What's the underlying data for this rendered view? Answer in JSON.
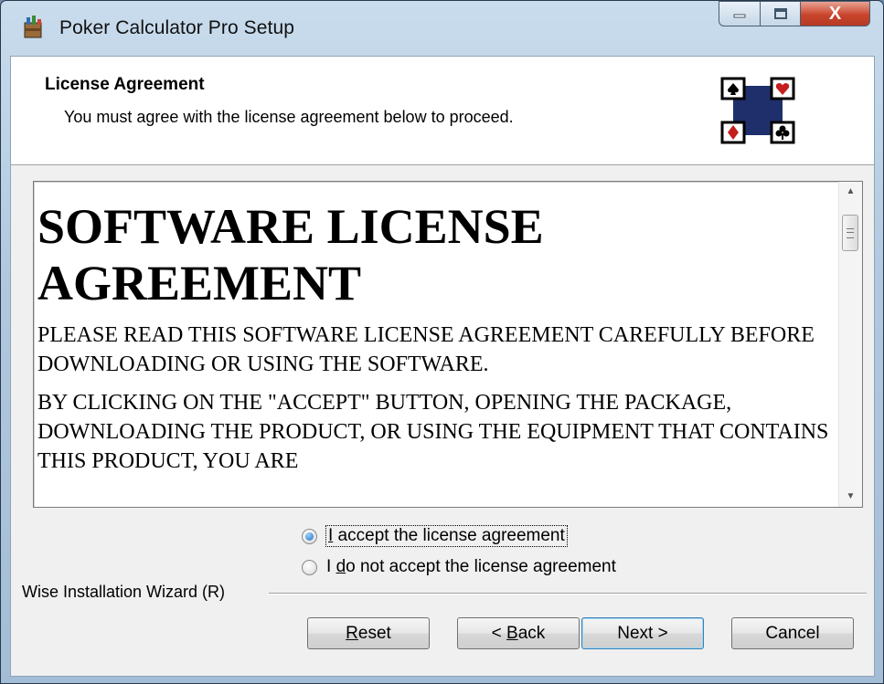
{
  "window": {
    "title": "Poker Calculator Pro Setup",
    "icon": "setup-package-icon",
    "controls": {
      "minimize": "minimize-icon",
      "maximize": "maximize-icon",
      "close_glyph": "X"
    }
  },
  "header": {
    "title": "License Agreement",
    "subtitle": "You must agree with the license agreement below to proceed.",
    "logo": "card-suits-logo"
  },
  "license": {
    "heading": "SOFTWARE LICENSE AGREEMENT",
    "paragraphs": [
      "PLEASE READ THIS SOFTWARE LICENSE AGREEMENT CAREFULLY BEFORE DOWNLOADING OR USING THE SOFTWARE.",
      "BY CLICKING ON THE \"ACCEPT\" BUTTON, OPENING THE PACKAGE, DOWNLOADING THE PRODUCT, OR USING THE EQUIPMENT THAT CONTAINS THIS PRODUCT, YOU ARE"
    ],
    "scroll_position": 0.05
  },
  "options": {
    "accept_prefix": "",
    "accept_access_key": "I",
    "accept_rest": " accept the license agreement",
    "decline_prefix": "I ",
    "decline_access_key": "d",
    "decline_rest": "o not accept the license agreement",
    "selected": "accept"
  },
  "footer": {
    "brand": "Wise Installation Wizard (R)"
  },
  "buttons": {
    "reset_key": "R",
    "reset_rest": "eset",
    "back_prefix": "< ",
    "back_key": "B",
    "back_rest": "ack",
    "next_label": "Next >",
    "cancel_label": "Cancel"
  },
  "colors": {
    "logo_blue": "#1f2f6b",
    "close_red": "#c9452c",
    "radio_selected": "#1d6fc4"
  }
}
